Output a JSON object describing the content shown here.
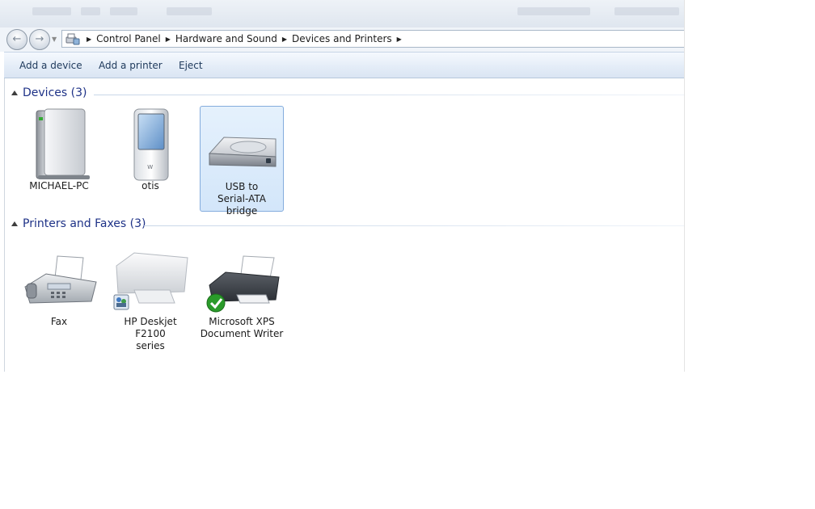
{
  "breadcrumb": [
    "Control Panel",
    "Hardware and Sound",
    "Devices and Printers"
  ],
  "command_bar": {
    "add_device": "Add a device",
    "add_printer": "Add a printer",
    "eject": "Eject"
  },
  "groups": {
    "devices": {
      "title": "Devices (3)",
      "items": [
        {
          "label": "MICHAEL-PC",
          "icon": "computer-icon"
        },
        {
          "label": "otis",
          "icon": "media-player-icon"
        },
        {
          "label_line1": "USB to",
          "label_line2": "Serial-ATA bridge",
          "icon": "external-drive-icon"
        }
      ]
    },
    "printers": {
      "title": "Printers and Faxes (3)",
      "items": [
        {
          "label": "Fax",
          "icon": "fax-icon"
        },
        {
          "label_line1": "HP Deskjet F2100",
          "label_line2": "series",
          "icon": "printer-icon"
        },
        {
          "label_line1": "Microsoft XPS",
          "label_line2": "Document Writer",
          "icon": "default-printer-icon"
        }
      ]
    }
  },
  "colors": {
    "group_title": "#1e3287",
    "command_text": "#1e395b",
    "selection": "#d3e6fa",
    "default_check": "#2a9b2a"
  }
}
